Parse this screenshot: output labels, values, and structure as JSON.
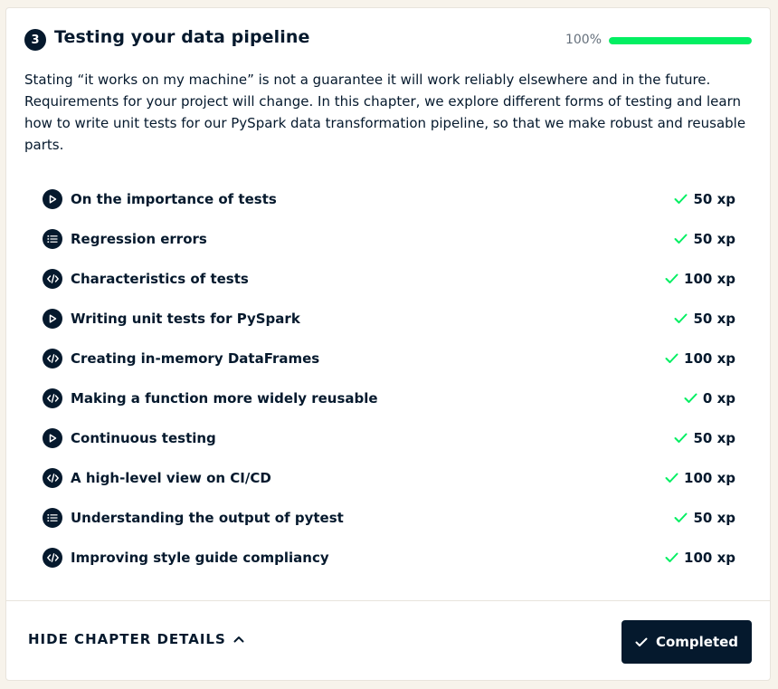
{
  "chapter": {
    "number": "3",
    "title": "Testing your data pipeline",
    "progress_label": "100%",
    "progress_fraction": 1.0,
    "description": "Stating “it works on my machine” is not a guarantee it will work reliably elsewhere and in the future. Requirements for your project will change. In this chapter, we explore different forms of testing and learn how to write unit tests for our PySpark data transformation pipeline, so that we make robust and reusable parts."
  },
  "exercises": [
    {
      "title": "On the importance of tests",
      "xp": "50 xp",
      "type": "video",
      "icon": "play-icon"
    },
    {
      "title": "Regression errors",
      "xp": "50 xp",
      "type": "multiple-choice",
      "icon": "list-icon"
    },
    {
      "title": "Characteristics of tests",
      "xp": "100 xp",
      "type": "code",
      "icon": "code-icon"
    },
    {
      "title": "Writing unit tests for PySpark",
      "xp": "50 xp",
      "type": "video",
      "icon": "play-icon"
    },
    {
      "title": "Creating in-memory DataFrames",
      "xp": "100 xp",
      "type": "code",
      "icon": "code-icon"
    },
    {
      "title": "Making a function more widely reusable",
      "xp": "0 xp",
      "type": "code",
      "icon": "code-icon"
    },
    {
      "title": "Continuous testing",
      "xp": "50 xp",
      "type": "video",
      "icon": "play-icon"
    },
    {
      "title": "A high-level view on CI/CD",
      "xp": "100 xp",
      "type": "code",
      "icon": "code-icon"
    },
    {
      "title": "Understanding the output of pytest",
      "xp": "50 xp",
      "type": "multiple-choice",
      "icon": "list-icon"
    },
    {
      "title": "Improving style guide compliancy",
      "xp": "100 xp",
      "type": "code",
      "icon": "code-icon"
    }
  ],
  "footer": {
    "hide_details_label": "HIDE CHAPTER DETAILS",
    "completed_label": "Completed"
  },
  "colors": {
    "navy": "#05192d",
    "accent_green": "#03ef62",
    "check_green": "#03ef62",
    "background": "#f7f3eb"
  }
}
